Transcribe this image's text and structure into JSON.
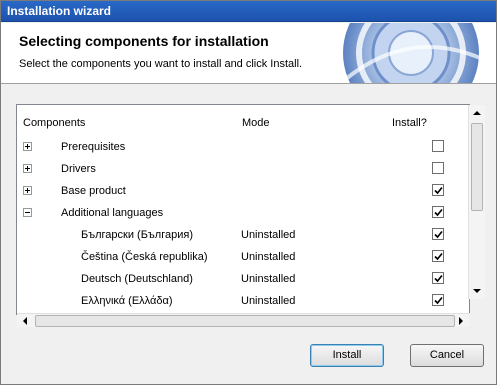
{
  "window": {
    "title": "Installation wizard"
  },
  "header": {
    "title": "Selecting components for installation",
    "subtitle": "Select the components you want to install and click Install."
  },
  "table": {
    "columns": {
      "components": "Components",
      "mode": "Mode",
      "install": "Install?"
    },
    "rows": [
      {
        "label": "Prerequisites",
        "mode": "",
        "expander": "plus",
        "checked": false
      },
      {
        "label": "Drivers",
        "mode": "",
        "expander": "plus",
        "checked": false
      },
      {
        "label": "Base product",
        "mode": "",
        "expander": "plus",
        "checked": true
      },
      {
        "label": "Additional languages",
        "mode": "",
        "expander": "minus",
        "checked": true
      },
      {
        "label": "Български (България)",
        "mode": "Uninstalled",
        "expander": "",
        "checked": true
      },
      {
        "label": "Čeština (Česká republika)",
        "mode": "Uninstalled",
        "expander": "",
        "checked": true
      },
      {
        "label": "Deutsch (Deutschland)",
        "mode": "Uninstalled",
        "expander": "",
        "checked": true
      },
      {
        "label": "Ελληνικά (Ελλάδα)",
        "mode": "Uninstalled",
        "expander": "",
        "checked": true
      }
    ]
  },
  "buttons": {
    "install": "Install",
    "cancel": "Cancel"
  },
  "icons": {
    "expand": "plus-box-icon",
    "collapse": "minus-box-icon",
    "check": "checkmark-icon",
    "scroll_up": "arrow-up-icon",
    "scroll_down": "arrow-down-icon",
    "scroll_left": "arrow-left-icon",
    "scroll_right": "arrow-right-icon"
  },
  "colors": {
    "titlebar": "#1c52ad",
    "header_bg": "#ffffff",
    "dialog_bg": "#f0f0f0"
  }
}
